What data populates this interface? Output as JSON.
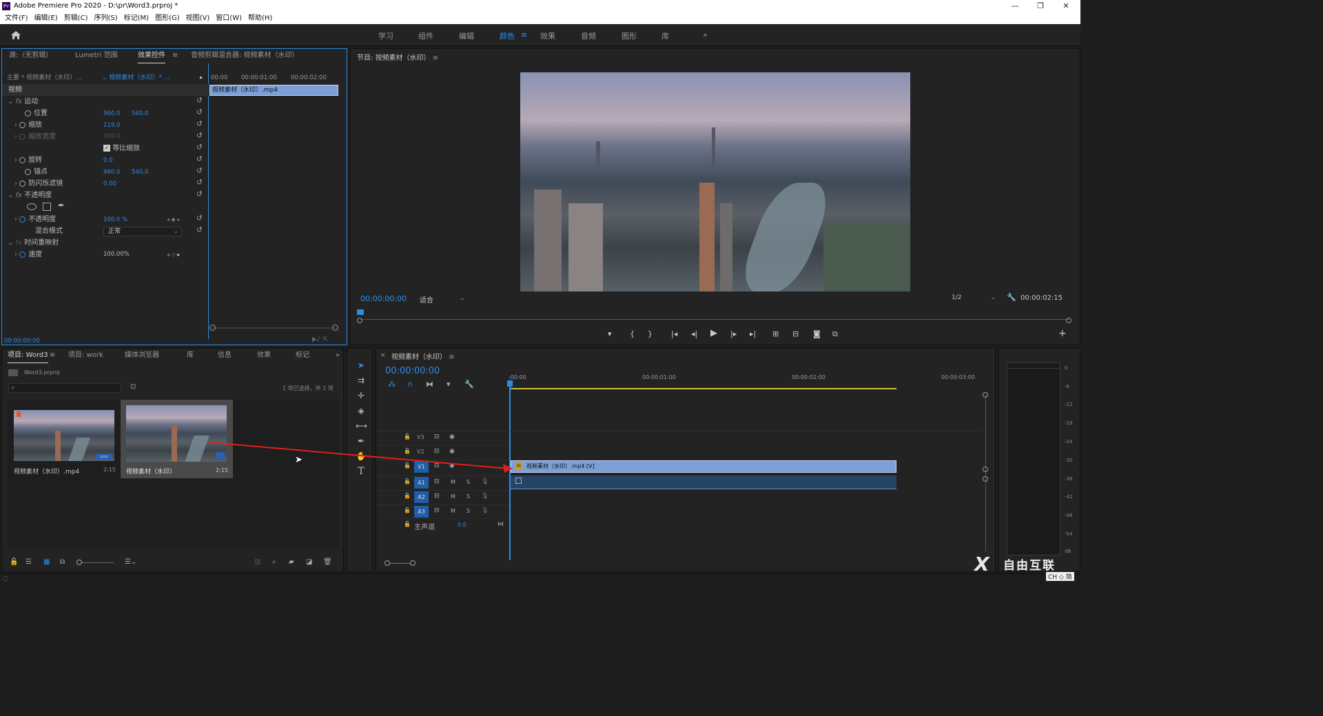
{
  "app": {
    "title": "Adobe Premiere Pro 2020 - D:\\pr\\Word3.prproj *",
    "logo": "Pr"
  },
  "menu": [
    "文件(F)",
    "编辑(E)",
    "剪辑(C)",
    "序列(S)",
    "标记(M)",
    "图形(G)",
    "视图(V)",
    "窗口(W)",
    "帮助(H)"
  ],
  "workspaces": [
    "学习",
    "组件",
    "编辑",
    "颜色",
    "效果",
    "音频",
    "图形",
    "库"
  ],
  "active_workspace": "颜色",
  "source_panel": {
    "tabs": [
      "源:（无剪辑）",
      "Lumetri 范围",
      "效果控件",
      "音频剪辑混合器: 视频素材（水印）"
    ],
    "master": "主要 * 视频素材（水印）...",
    "clip": "视频素材（水印）* ...",
    "mini_times": [
      "00:00",
      "00:00:01:00",
      "00:00:02:00"
    ],
    "mini_clip": "视频素材（水印）.mp4",
    "section_video": "视频",
    "motion": "运动",
    "position_label": "位置",
    "position_x": "960.0",
    "position_y": "540.0",
    "scale_label": "缩放",
    "scale_val": "119.0",
    "scale_width_label": "缩放宽度",
    "scale_width_val": "100.0",
    "uniform_scale": "等比缩放",
    "rotation_label": "旋转",
    "rotation_val": "0.0",
    "anchor_label": "锚点",
    "anchor_x": "960.0",
    "anchor_y": "540.0",
    "antiflicker_label": "防闪烁滤镜",
    "antiflicker_val": "0.00",
    "opacity_group": "不透明度",
    "opacity_label": "不透明度",
    "opacity_val": "100.0 %",
    "blend_label": "混合模式",
    "blend_val": "正常",
    "time_remap": "时间重映射",
    "speed_label": "速度",
    "speed_val": "100.00%",
    "timecode": "00:00:00:00"
  },
  "program": {
    "title": "节目: 视频素材（水印）",
    "timecode": "00:00:00:00",
    "fit": "适合",
    "resolution": "1/2",
    "duration": "00:00:02:15"
  },
  "project": {
    "tabs": [
      "项目: Word3",
      "项目: work",
      "媒体浏览器",
      "库",
      "信息",
      "效果",
      "标记"
    ],
    "file": "Word3.prproj",
    "selection": "1 项已选择，共 2 项",
    "items": [
      {
        "name": "视频素材（水印）.mp4",
        "duration": "2:15"
      },
      {
        "name": "视频素材（水印）",
        "duration": "2:15"
      }
    ]
  },
  "timeline": {
    "title": "视频素材（水印）",
    "timecode": "00:00:00:00",
    "ruler": [
      ":00:00",
      "00:00:01:00",
      "00:00:02:00",
      "00:00:03:00"
    ],
    "tracks_video": [
      "V3",
      "V2",
      "V1"
    ],
    "tracks_audio": [
      "A1",
      "A2",
      "A3"
    ],
    "master": "主声道",
    "master_val": "0.0",
    "clip": "视频素材（水印）.mp4 [V]",
    "m": "M",
    "s": "S"
  },
  "meter": {
    "labels": [
      "0",
      "-6",
      "-12",
      "-18",
      "-24",
      "-30",
      "-36",
      "-42",
      "-48",
      "-54",
      "dB"
    ]
  },
  "watermark": {
    "text": "自由互联",
    "lang": "CH ◇ 简"
  }
}
